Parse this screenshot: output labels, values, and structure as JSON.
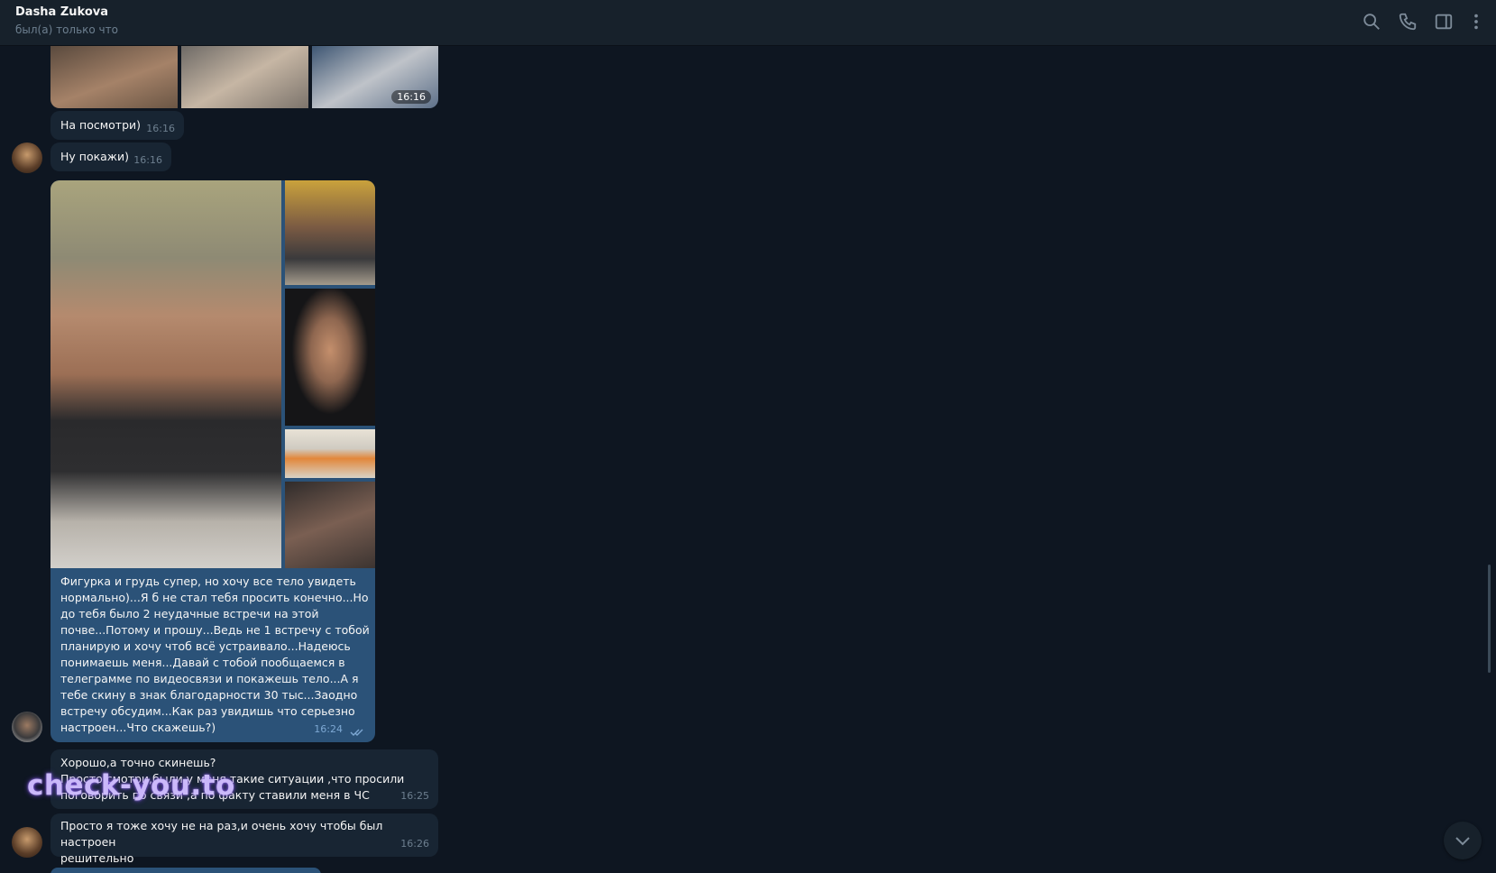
{
  "header": {
    "contact_name": "Dasha Zukova",
    "status": "был(а) только что"
  },
  "messages": [
    {
      "time": "16:16"
    },
    {
      "text": "На посмотри)",
      "time": "16:16"
    },
    {
      "text": "Ну покажи)",
      "time": "16:16"
    },
    {
      "text": "Фигурка и грудь супер, но хочу все тело увидеть\nнормально)...Я б не стал тебя просить конечно...Но\nдо тебя было 2 неудачные встречи на этой\nпочве...Потому и прошу...Ведь не 1 встречу с тобой\nпланирую и хочу чтоб всё устраивало...Надеюсь\nпонимаешь меня...Давай с тобой пообщаемся в\nтелеграмме  по видеосвязи и покажешь тело...А я\nтебе скину в знак благодарности 30 тыс...Заодно\nвстречу обсудим...Как раз увидишь что серьезно\nнастроен...Что скажешь?)",
      "time": "16:24"
    },
    {
      "text": "Хорошо,а точно скинешь?\nПросто смотри,были у меня такие ситуации ,что просили\nпоговорить по связи ,а по факту ставили меня в ЧС",
      "time": "16:25"
    },
    {
      "text": "Просто я тоже хочу не на раз,и очень хочу чтобы был настроен\nрешительно",
      "time": "16:26"
    }
  ],
  "watermark": "check-you.to",
  "colors": {
    "background": "#0e1621",
    "header": "#17212b",
    "incoming_bubble": "#182533",
    "outgoing_bubble": "#2b5278",
    "accent_check": "#7da8d3"
  },
  "icons": [
    "search-icon",
    "phone-icon",
    "sidebar-toggle-icon",
    "more-icon",
    "chevron-down-icon",
    "double-check-icon"
  ]
}
